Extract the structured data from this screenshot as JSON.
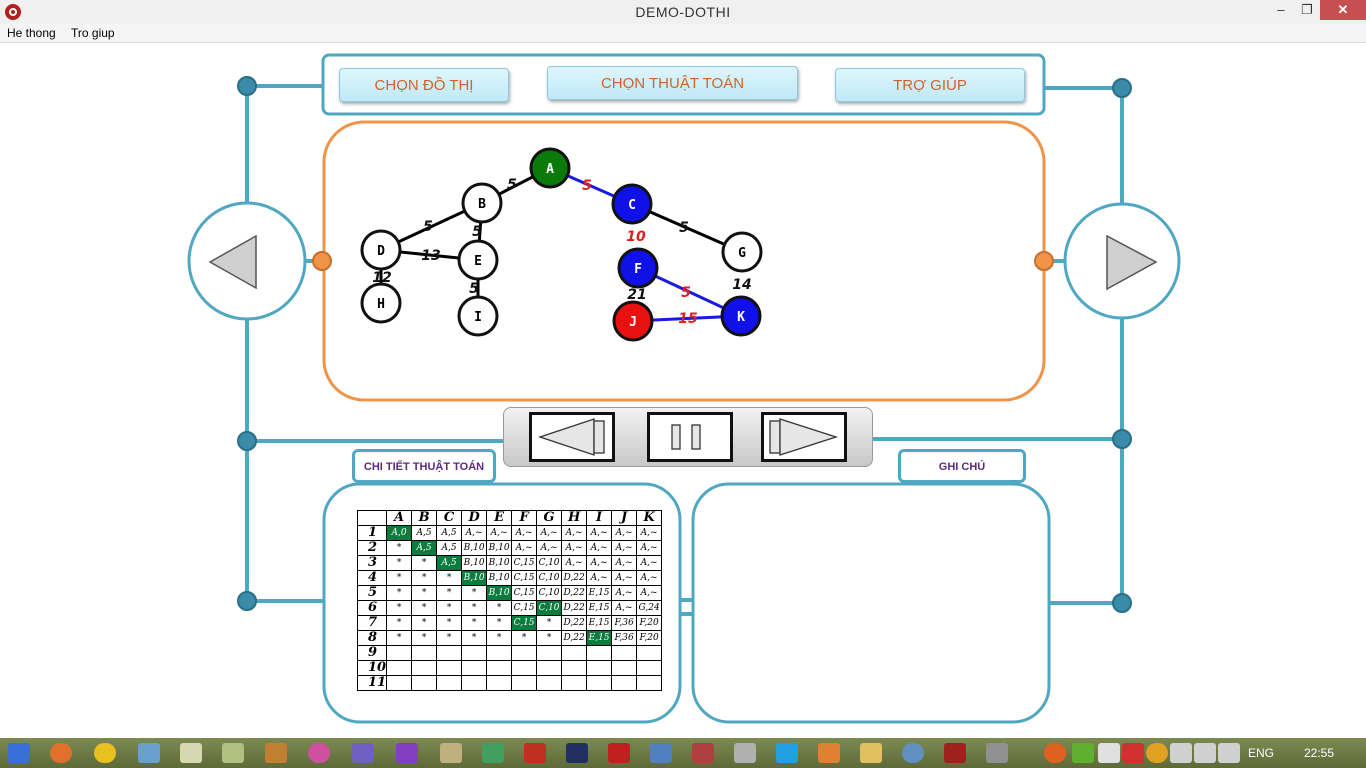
{
  "window": {
    "title": "DEMO-DOTHI",
    "close_glyph": "✕",
    "max_glyph": "❐",
    "min_glyph": "–"
  },
  "menu": {
    "items": [
      "He thong",
      "Tro giup"
    ]
  },
  "top_buttons": {
    "choose_graph": "CHỌN ĐỒ THỊ",
    "choose_algorithm": "CHỌN THUẬT TOÁN",
    "help": "TRỢ GIÚP"
  },
  "panels": {
    "algorithm_details": "CHI TIẾT THUẬT TOÁN",
    "notes": "GHI CHÚ"
  },
  "graph": {
    "nodes": [
      {
        "id": "A",
        "state": "visited"
      },
      {
        "id": "B",
        "state": "unvisited"
      },
      {
        "id": "C",
        "state": "active"
      },
      {
        "id": "D",
        "state": "unvisited"
      },
      {
        "id": "E",
        "state": "unvisited"
      },
      {
        "id": "G",
        "state": "unvisited"
      },
      {
        "id": "F",
        "state": "active"
      },
      {
        "id": "H",
        "state": "unvisited"
      },
      {
        "id": "I",
        "state": "unvisited"
      },
      {
        "id": "J",
        "state": "current"
      },
      {
        "id": "K",
        "state": "active"
      }
    ],
    "edges": [
      {
        "from": "A",
        "to": "B",
        "weight": "5",
        "highlight": false
      },
      {
        "from": "A",
        "to": "C",
        "weight": "5",
        "highlight": true
      },
      {
        "from": "B",
        "to": "D",
        "weight": "5",
        "highlight": false
      },
      {
        "from": "B",
        "to": "E",
        "weight": "5",
        "highlight": false
      },
      {
        "from": "D",
        "to": "E",
        "weight": "13",
        "highlight": false
      },
      {
        "from": "D",
        "to": "H",
        "weight": "12",
        "highlight": false
      },
      {
        "from": "E",
        "to": "I",
        "weight": "5",
        "highlight": false
      },
      {
        "from": "C",
        "to": "G",
        "weight": "5",
        "highlight": false
      },
      {
        "from": "C",
        "to": "F",
        "weight": "10",
        "highlight": true
      },
      {
        "from": "F",
        "to": "K",
        "weight": "5",
        "highlight": true
      },
      {
        "from": "F",
        "to": "J",
        "weight": "21",
        "highlight": false
      },
      {
        "from": "J",
        "to": "K",
        "weight": "15",
        "highlight": true
      },
      {
        "from": "G",
        "to": "K",
        "weight": "14",
        "highlight": false
      }
    ],
    "colors": {
      "visited": "#0a7a0a",
      "active": "#1010e8",
      "current": "#e81010",
      "unvisited": "#ffffff",
      "edge_highlight": "#1a1ae0",
      "weight_highlight": "#e02020"
    }
  },
  "table": {
    "columns": [
      "A",
      "B",
      "C",
      "D",
      "E",
      "F",
      "G",
      "H",
      "I",
      "J",
      "K"
    ],
    "rows": [
      {
        "label": "1",
        "cells": [
          "A,0",
          "A,5",
          "A,5",
          "A,~",
          "A,~",
          "A,~",
          "A,~",
          "A,~",
          "A,~",
          "A,~",
          "A,~"
        ],
        "hl": 0
      },
      {
        "label": "2",
        "cells": [
          "*",
          "A,5",
          "A,5",
          "B,10",
          "B,10",
          "A,~",
          "A,~",
          "A,~",
          "A,~",
          "A,~",
          "A,~"
        ],
        "hl": 1
      },
      {
        "label": "3",
        "cells": [
          "*",
          "*",
          "A,5",
          "B,10",
          "B,10",
          "C,15",
          "C,10",
          "A,~",
          "A,~",
          "A,~",
          "A,~"
        ],
        "hl": 2
      },
      {
        "label": "4",
        "cells": [
          "*",
          "*",
          "*",
          "B,10",
          "B,10",
          "C,15",
          "C,10",
          "D,22",
          "A,~",
          "A,~",
          "A,~"
        ],
        "hl": 3
      },
      {
        "label": "5",
        "cells": [
          "*",
          "*",
          "*",
          "*",
          "B,10",
          "C,15",
          "C,10",
          "D,22",
          "E,15",
          "A,~",
          "A,~"
        ],
        "hl": 4
      },
      {
        "label": "6",
        "cells": [
          "*",
          "*",
          "*",
          "*",
          "*",
          "C,15",
          "C,10",
          "D,22",
          "E,15",
          "A,~",
          "G,24"
        ],
        "hl": 6
      },
      {
        "label": "7",
        "cells": [
          "*",
          "*",
          "*",
          "*",
          "*",
          "C,15",
          "*",
          "D,22",
          "E,15",
          "F,36",
          "F,20"
        ],
        "hl": 5
      },
      {
        "label": "8",
        "cells": [
          "*",
          "*",
          "*",
          "*",
          "*",
          "*",
          "*",
          "D,22",
          "E,15",
          "F,36",
          "F,20"
        ],
        "hl": 8
      },
      {
        "label": "9",
        "cells": [
          "",
          "",
          "",
          "",
          "",
          "",
          "",
          "",
          "",
          "",
          ""
        ],
        "hl": -1
      },
      {
        "label": "10",
        "cells": [
          "",
          "",
          "",
          "",
          "",
          "",
          "",
          "",
          "",
          "",
          ""
        ],
        "hl": -1
      },
      {
        "label": "11",
        "cells": [
          "",
          "",
          "",
          "",
          "",
          "",
          "",
          "",
          "",
          "",
          ""
        ],
        "hl": -1
      }
    ]
  },
  "taskbar": {
    "language": "ENG",
    "time": "22:55"
  }
}
